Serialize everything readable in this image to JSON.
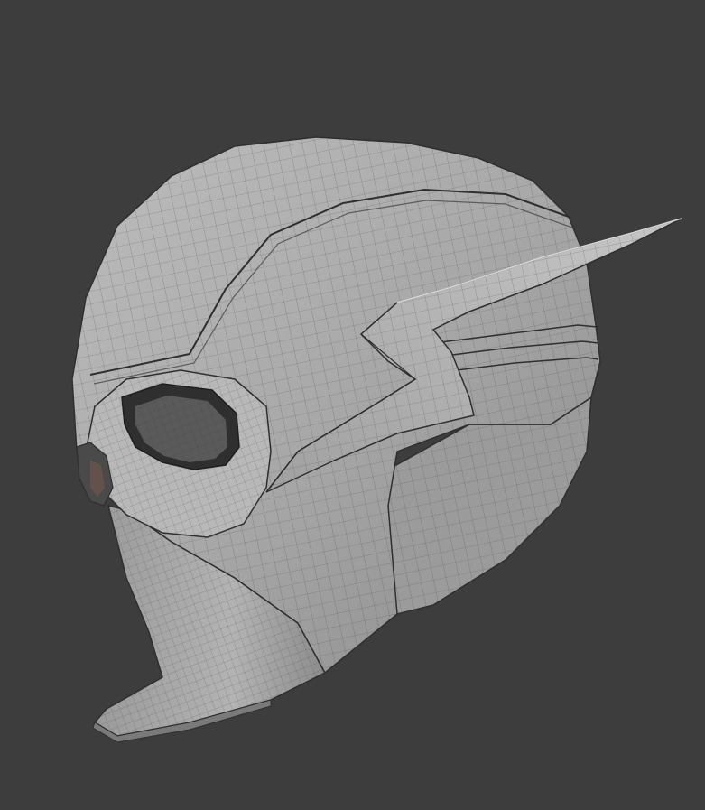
{
  "viewport": {
    "background_color": "#3d3d3d",
    "mesh_base_color": "#a6a6a6",
    "mesh_light_color": "#c4c4c4",
    "mesh_dark_color": "#6e6e6e",
    "wire_color": "#3a3a3a"
  },
  "model": {
    "parts": [
      "helmet-dome",
      "wing-fin",
      "eye-socket",
      "cheek-guard",
      "jaw-visor"
    ]
  }
}
